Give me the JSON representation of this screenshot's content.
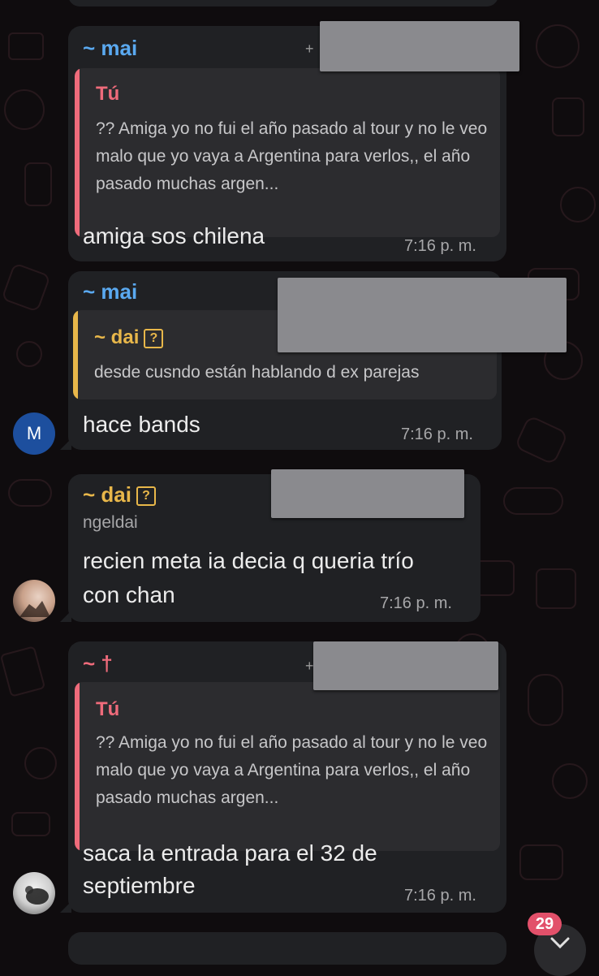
{
  "messages": [
    {
      "sender": "~ mai",
      "phone_prefix": "+",
      "reply": {
        "sender": "Tú",
        "text": "?? Amiga yo no fui el año pasado al tour y no le veo malo que yo vaya a Argentina para verlos,, el año pasado muchas argen..."
      },
      "text": "amiga sos chilena",
      "time": "7:16 p. m."
    },
    {
      "sender": "~ mai",
      "avatar_initial": "M",
      "reply": {
        "sender": "~ dai",
        "text": "desde cusndo están hablando d ex parejas"
      },
      "text": "hace bands",
      "time": "7:16 p. m."
    },
    {
      "sender": "~ dai",
      "handle": "ngeldai",
      "text_line1": "recien meta ia decia q queria trío",
      "text_line2": "con chan",
      "time": "7:16 p. m."
    },
    {
      "sender": "~ †",
      "phone_prefix": "+",
      "reply": {
        "sender": "Tú",
        "text": "?? Amiga yo no fui el año pasado al tour y no le veo malo que yo vaya a Argentina para verlos,, el año pasado muchas argen..."
      },
      "text_line1": "saca la entrada para el 32 de",
      "text_line2": "septiembre",
      "time": "7:16 p. m."
    }
  ],
  "unread_badge": "29",
  "colors": {
    "blue_sender": "#5aa9f0",
    "yellow_sender": "#e8b74a",
    "pink_sender": "#ef6b7b",
    "bubble": "#202124",
    "badge": "#e2506a"
  }
}
